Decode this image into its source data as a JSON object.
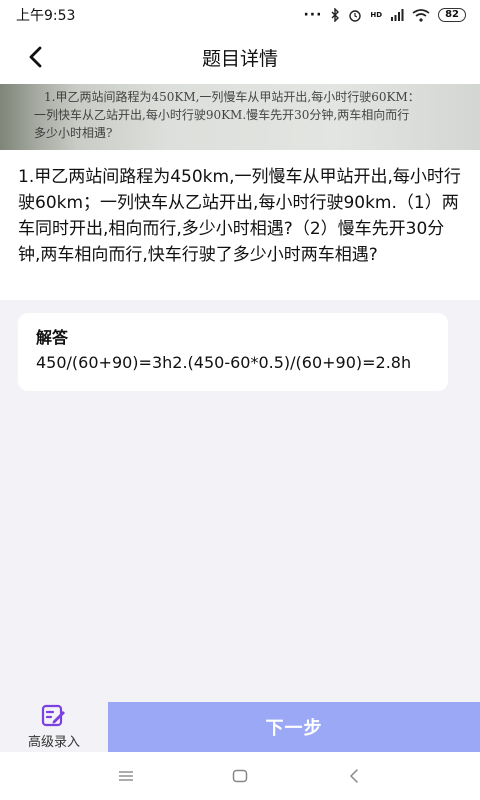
{
  "status_bar": {
    "time": "上午9:53",
    "network_label": "HD",
    "battery": "82"
  },
  "header": {
    "title": "题目详情"
  },
  "photo": {
    "lines": [
      "1.甲乙两站间路程为450KM,一列慢车从甲站开出,每小时行驶60KM：",
      "一列快车从乙站开出,每小时行驶90KM.慢车先开30分钟,两车相向而行",
      "多少小时相遇?"
    ]
  },
  "question": {
    "text": "1.甲乙两站间路程为450km,一列慢车从甲站开出,每小时行驶60km；一列快车从乙站开出,每小时行驶90km.（1）两车同时开出,相向而行,多少小时相遇?（2）慢车先开30分钟,两车相向而行,快车行驶了多少小时两车相遇?"
  },
  "answer": {
    "title": "解答",
    "text": "450/(60+90)=3h2.(450-60*0.5)/(60+90)=2.8h"
  },
  "bottom": {
    "advanced_label": "高级录入",
    "next_label": "下一步"
  },
  "colors": {
    "accent": "#9aa8f6",
    "icon_purple": "#7b3fe4",
    "background": "#f3f2f6"
  }
}
